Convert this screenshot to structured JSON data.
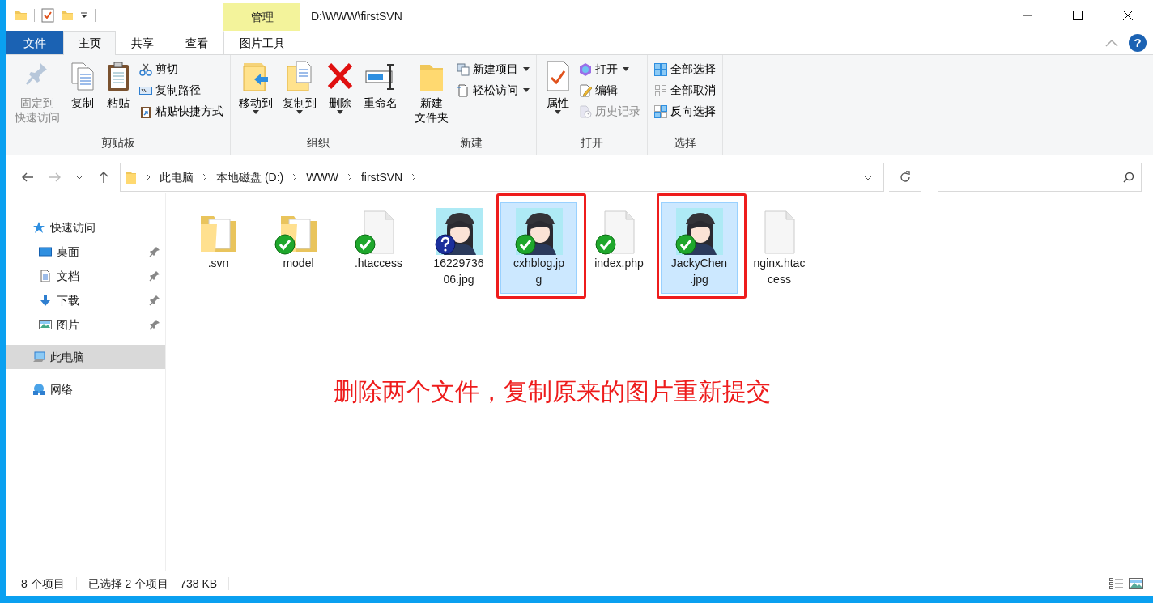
{
  "title_bar": {
    "context_header": "管理",
    "path": "D:\\WWW\\firstSVN"
  },
  "ribbon_tabs": [
    {
      "label": "文件",
      "kind": "file",
      "selected": false
    },
    {
      "label": "主页",
      "kind": "normal",
      "selected": true
    },
    {
      "label": "共享",
      "kind": "normal",
      "selected": false
    },
    {
      "label": "查看",
      "kind": "normal",
      "selected": false
    },
    {
      "label": "图片工具",
      "kind": "context",
      "selected": false
    }
  ],
  "help": "?",
  "ribbon_groups": [
    {
      "label": "剪贴板",
      "buttons": [
        {
          "label_lines": [
            "固定到",
            "快速访问"
          ],
          "kind": "large",
          "disabled": true,
          "dropdown": false
        },
        {
          "label_lines": [
            "复制"
          ],
          "kind": "large",
          "disabled": false,
          "dropdown": false
        },
        {
          "label_lines": [
            "粘贴"
          ],
          "kind": "large",
          "disabled": false,
          "dropdown": false
        },
        {
          "label_lines": [
            "剪切"
          ],
          "kind": "small",
          "disabled": false,
          "dropdown": false
        },
        {
          "label_lines": [
            "复制路径"
          ],
          "kind": "small",
          "disabled": false,
          "dropdown": false
        },
        {
          "label_lines": [
            "粘贴快捷方式"
          ],
          "kind": "small",
          "disabled": false,
          "dropdown": false
        }
      ]
    },
    {
      "label": "组织",
      "buttons": [
        {
          "label_lines": [
            "移动到"
          ],
          "kind": "large",
          "disabled": false,
          "dropdown": true
        },
        {
          "label_lines": [
            "复制到"
          ],
          "kind": "large",
          "disabled": false,
          "dropdown": true
        },
        {
          "label_lines": [
            "删除"
          ],
          "kind": "large",
          "disabled": false,
          "dropdown": true
        },
        {
          "label_lines": [
            "重命名"
          ],
          "kind": "large",
          "disabled": false,
          "dropdown": false
        }
      ]
    },
    {
      "label": "新建",
      "buttons": [
        {
          "label_lines": [
            "新建",
            "文件夹"
          ],
          "kind": "large",
          "disabled": false,
          "dropdown": false
        },
        {
          "label_lines": [
            "新建项目"
          ],
          "kind": "small",
          "disabled": false,
          "dropdown": true
        },
        {
          "label_lines": [
            "轻松访问"
          ],
          "kind": "small",
          "disabled": false,
          "dropdown": true
        }
      ]
    },
    {
      "label": "打开",
      "buttons": [
        {
          "label_lines": [
            "属性"
          ],
          "kind": "large",
          "disabled": false,
          "dropdown": true
        },
        {
          "label_lines": [
            "打开"
          ],
          "kind": "small",
          "disabled": false,
          "dropdown": true
        },
        {
          "label_lines": [
            "编辑"
          ],
          "kind": "small",
          "disabled": false,
          "dropdown": false
        },
        {
          "label_lines": [
            "历史记录"
          ],
          "kind": "small",
          "disabled": true,
          "dropdown": false
        }
      ]
    },
    {
      "label": "选择",
      "buttons": [
        {
          "label_lines": [
            "全部选择"
          ],
          "kind": "small",
          "disabled": false,
          "dropdown": false
        },
        {
          "label_lines": [
            "全部取消"
          ],
          "kind": "small",
          "disabled": false,
          "dropdown": false
        },
        {
          "label_lines": [
            "反向选择"
          ],
          "kind": "small",
          "disabled": false,
          "dropdown": false
        }
      ]
    }
  ],
  "address": {
    "crumbs": [
      "此电脑",
      "本地磁盘 (D:)",
      "WWW",
      "firstSVN"
    ]
  },
  "sidebar": [
    {
      "label": "快速访问",
      "selected": false,
      "children": [
        {
          "label": "桌面",
          "pinned": true,
          "selected": false
        },
        {
          "label": "文档",
          "pinned": true,
          "selected": false
        },
        {
          "label": "下载",
          "pinned": true,
          "selected": false
        },
        {
          "label": "图片",
          "pinned": true,
          "selected": false
        }
      ]
    },
    {
      "label": "此电脑",
      "selected": true
    },
    {
      "label": "网络",
      "selected": false
    }
  ],
  "files": [
    {
      "name_lines": [
        ".svn"
      ],
      "kind": "folder",
      "versioned": false,
      "unversioned": false,
      "selected": false,
      "highlighted": false
    },
    {
      "name_lines": [
        "model"
      ],
      "kind": "folder",
      "versioned": true,
      "unversioned": false,
      "selected": false,
      "highlighted": false
    },
    {
      "name_lines": [
        ".htaccess"
      ],
      "kind": "file",
      "versioned": true,
      "unversioned": false,
      "selected": false,
      "highlighted": false
    },
    {
      "name_lines": [
        "16229736",
        "06.jpg"
      ],
      "versioned": false,
      "unversioned": true,
      "selected": false,
      "highlighted": false
    },
    {
      "name_lines": [
        "cxhblog.jp",
        "g"
      ],
      "versioned": true,
      "unversioned": false,
      "selected": true,
      "highlighted": true
    },
    {
      "name_lines": [
        "index.php"
      ],
      "kind": "file",
      "versioned": true,
      "unversioned": false,
      "selected": false,
      "highlighted": false
    },
    {
      "name_lines": [
        "JackyChen",
        ".jpg"
      ],
      "versioned": true,
      "unversioned": false,
      "selected": true,
      "highlighted": true
    },
    {
      "name_lines": [
        "nginx.htac",
        "cess"
      ],
      "kind": "file",
      "versioned": false,
      "unversioned": false,
      "selected": false,
      "highlighted": false
    }
  ],
  "annotation": "删除两个文件，复制原来的图片重新提交",
  "status_bar": {
    "item_count": "8 个项目",
    "selection": "已选择 2 个项目",
    "size": "738 KB"
  }
}
